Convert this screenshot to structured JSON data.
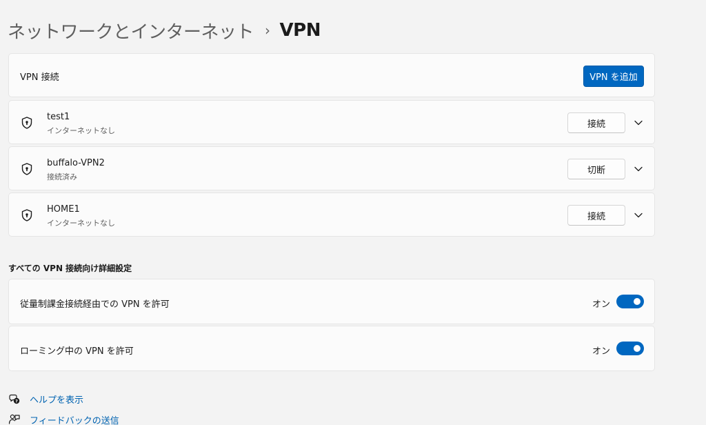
{
  "breadcrumb": {
    "parent": "ネットワークとインターネット",
    "separator": "›",
    "current": "VPN"
  },
  "vpn_section": {
    "label": "VPN 接続",
    "add_button": "VPN を追加"
  },
  "connections": [
    {
      "name": "test1",
      "status": "インターネットなし",
      "button": "接続",
      "icon": "shield-icon"
    },
    {
      "name": "buffalo-VPN2",
      "status": "接続済み",
      "button": "切断",
      "icon": "shield-icon"
    },
    {
      "name": "HOME1",
      "status": "インターネットなし",
      "button": "接続",
      "icon": "shield-icon"
    }
  ],
  "advanced": {
    "title": "すべての VPN 接続向け詳細設定",
    "settings": [
      {
        "label": "従量制課金接続経由での VPN を許可",
        "state": "オン",
        "on": true
      },
      {
        "label": "ローミング中の VPN を許可",
        "state": "オン",
        "on": true
      }
    ]
  },
  "links": {
    "help": "ヘルプを表示",
    "feedback": "フィードバックの送信"
  },
  "colors": {
    "accent": "#0067c0",
    "link": "#0063b1",
    "background": "#f3f3f3",
    "card": "#fbfbfb"
  }
}
